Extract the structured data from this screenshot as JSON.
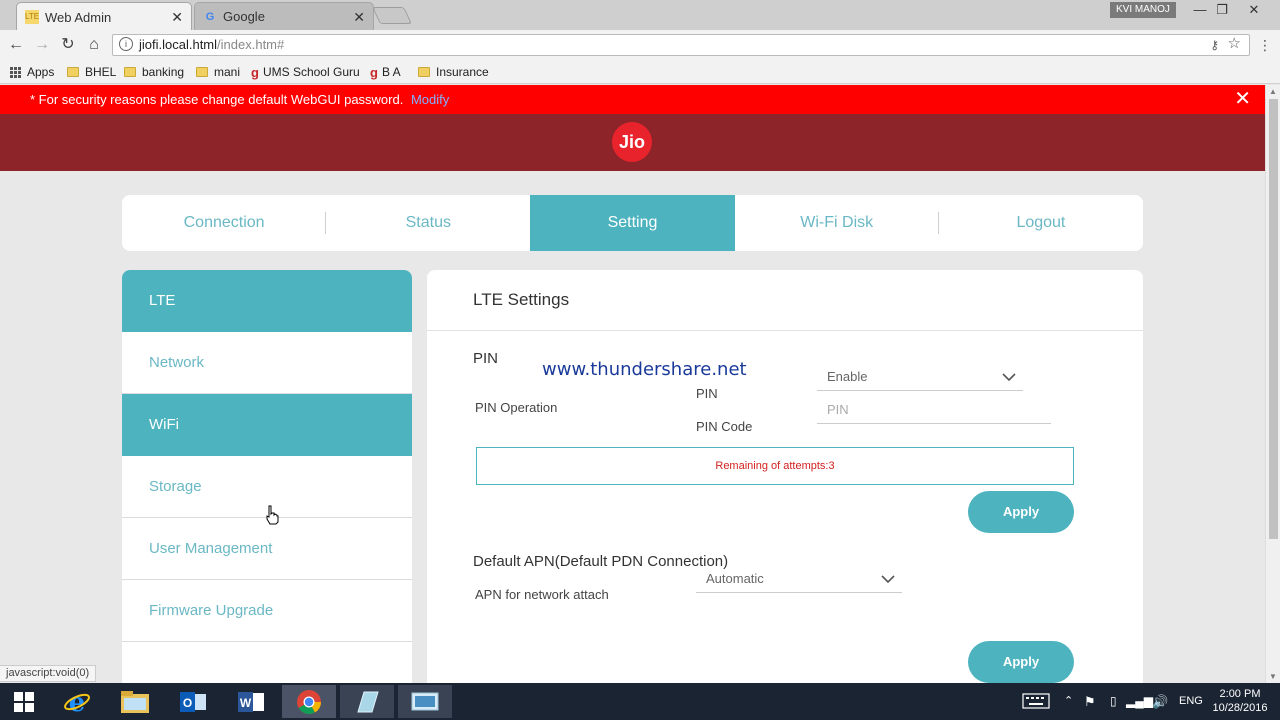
{
  "browser": {
    "tabs": [
      {
        "title": "Web Admin",
        "favicon": "LTE",
        "active": true
      },
      {
        "title": "Google",
        "favicon": "G",
        "active": false
      }
    ],
    "profile_name": "KVI MANOJ",
    "url_host": "jiofi.local.html",
    "url_path": "/index.htm#",
    "bookmarks": [
      "Apps",
      "BHEL",
      "banking",
      "mani",
      "UMS School Guru",
      "B A",
      "Insurance"
    ],
    "status_text": "javascript:void(0)"
  },
  "alert": {
    "text": "*  For security reasons please change default WebGUI password.",
    "link": "Modify",
    "close": "✕"
  },
  "header": {
    "logo_text": "Jio"
  },
  "topnav": [
    "Connection",
    "Status",
    "Setting",
    "Wi-Fi Disk",
    "Logout"
  ],
  "sidebar": [
    "LTE",
    "Network",
    "WiFi",
    "Storage",
    "User Management",
    "Firmware Upgrade"
  ],
  "content": {
    "title": "LTE  Settings",
    "watermark": "www.thundershare.net",
    "pin_section": "PIN",
    "pin_operation_label": "PIN  Operation",
    "pin_label": "PIN",
    "pin_value": "Enable",
    "pin_code_label": "PIN  Code",
    "pin_code_placeholder": "PIN",
    "attempts_text": "Remaining of attempts:3",
    "apply_label": "Apply",
    "apn_section": "Default  APN(Default  PDN  Connection)",
    "apn_label": "APN  for  network  attach",
    "apn_value": "Automatic"
  },
  "taskbar": {
    "language": "ENG",
    "time": "2:00 PM",
    "date": "10/28/2016"
  },
  "colors": {
    "alert_red": "#fe0000",
    "header_maroon": "#8c2429",
    "accent_teal": "#4db3be",
    "jio_red": "#e8232c"
  }
}
